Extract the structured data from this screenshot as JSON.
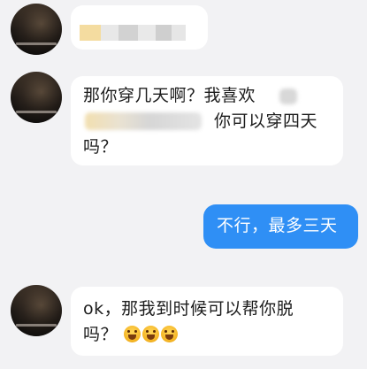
{
  "conversation": {
    "messages": [
      {
        "sender": "contact",
        "text": ""
      },
      {
        "sender": "contact",
        "line1": "那你穿几天啊？我喜欢",
        "line2_tail": "你可以穿四天",
        "line3": "吗？"
      },
      {
        "sender": "me",
        "text": "不行，最多三天"
      },
      {
        "sender": "contact",
        "line1": "ok，那我到时候可以帮你脱",
        "line2": "吗？"
      }
    ]
  },
  "colors": {
    "background": "#f2f2f4",
    "incoming_bubble": "#ffffff",
    "outgoing_bubble": "#2f8ff5",
    "outgoing_text": "#ffffff",
    "incoming_text": "#1c1c1c"
  },
  "icons": {
    "reaction_emoji": "scared-face-emoji"
  }
}
